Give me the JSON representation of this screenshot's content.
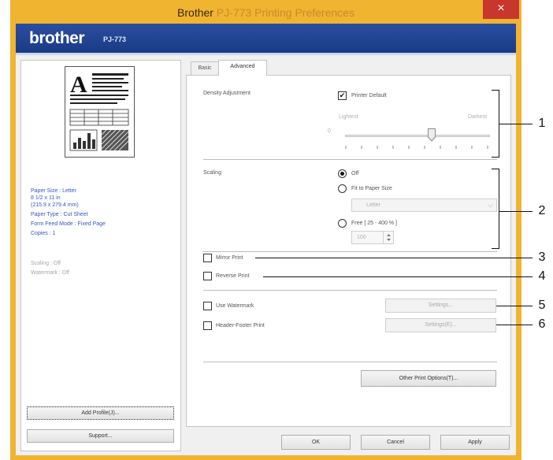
{
  "window": {
    "title_app": "Brother",
    "title_rest": "PJ-773 Printing Preferences",
    "close_glyph": "×"
  },
  "banner": {
    "logo": "brother",
    "model": "PJ-773"
  },
  "left": {
    "paper_size": "Paper Size : Letter",
    "paper_dims_in": "8 1/2 x 11 in",
    "paper_dims_mm": "(215.9 x 279.4 mm)",
    "paper_type": "Paper Type : Cut Sheet",
    "form_feed": "Form Feed Mode : Fixed Page",
    "copies": "Copies : 1",
    "scaling": "Scaling : Off",
    "watermark": "Watermark : Off",
    "add_profile_label": "Add Profile(J)...",
    "support_label": "Support..."
  },
  "tabs": [
    {
      "label": "Basic"
    },
    {
      "label": "Advanced"
    }
  ],
  "advanced": {
    "density_label": "Density Adjustment",
    "printer_default_label": "Printer Default",
    "printer_default_checked": true,
    "lightest_label": "Lightest",
    "darkest_label": "Darkest",
    "density_value": "0",
    "density_level": 0.6,
    "scaling_label": "Scaling",
    "scaling_off_label": "Off",
    "fit_to_paper_label": "Fit to Paper Size",
    "paper_select_value": "Letter",
    "free_label": "Free [ 25 - 400 % ]",
    "free_value": "100",
    "mirror_label": "Mirror Print",
    "reverse_label": "Reverse Print",
    "watermark_label": "Use Watermark",
    "watermark_settings_label": "Settings...",
    "header_footer_label": "Header-Footer Print",
    "header_footer_settings_label": "Settings(E)...",
    "other_options_label": "Other Print Options(T)..."
  },
  "footer": {
    "ok_label": "OK",
    "cancel_label": "Cancel",
    "apply_label": "Apply"
  },
  "callouts": [
    "1",
    "2",
    "3",
    "4",
    "5",
    "6"
  ],
  "colors": {
    "title_bar": "#f0b430",
    "close": "#c8372d",
    "banner": "#1f4496",
    "info_text": "#3a56c8"
  }
}
